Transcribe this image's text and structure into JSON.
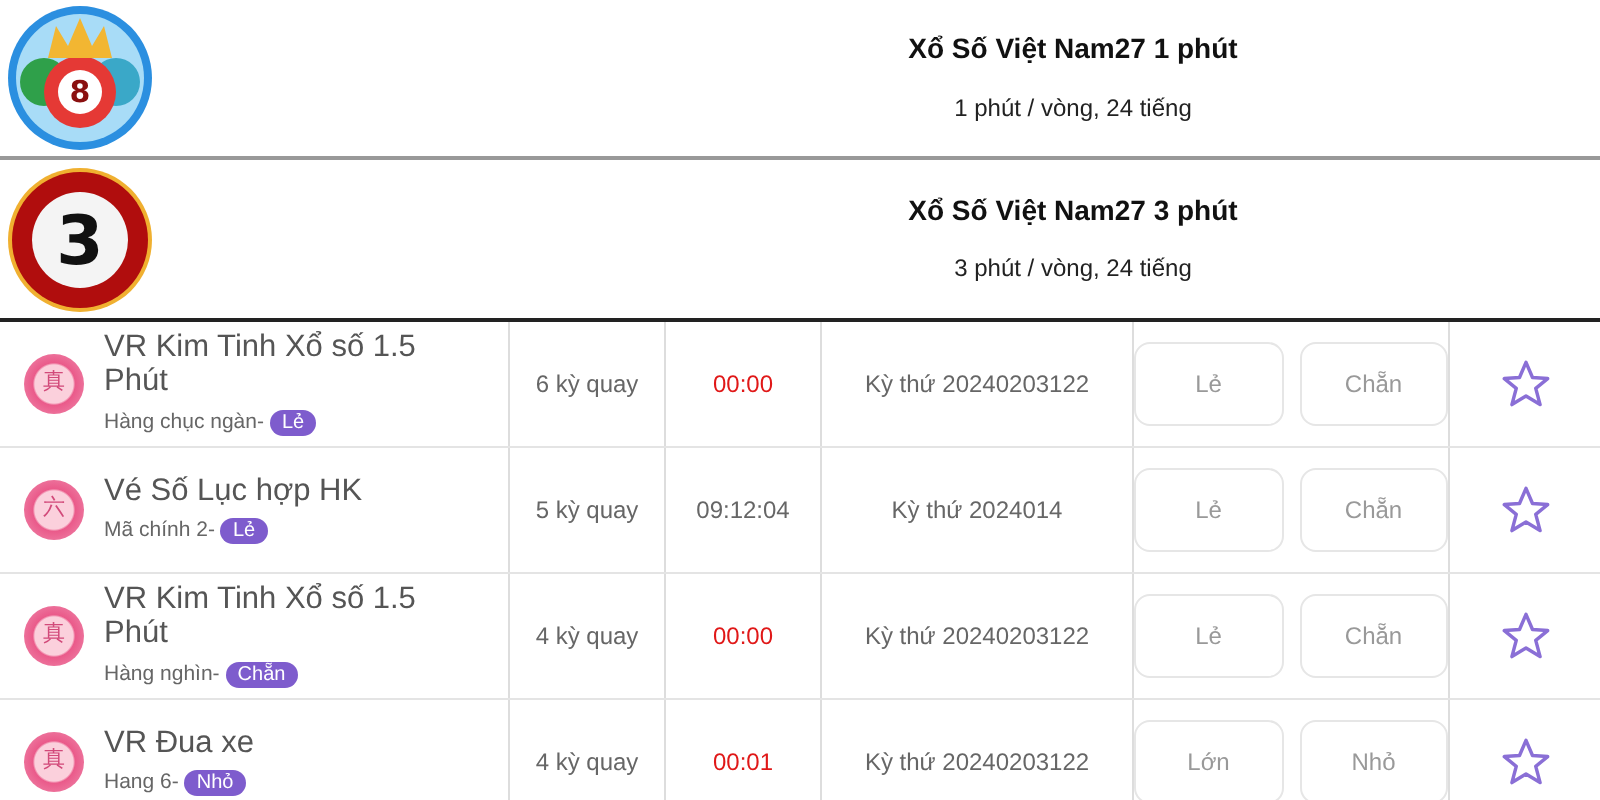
{
  "games": [
    {
      "logo_number": "8",
      "kind": "crown",
      "title": "Xổ Số Việt Nam27 1 phút",
      "subtitle": "1 phút / vòng, 24 tiếng"
    },
    {
      "logo_number": "3",
      "kind": "ring",
      "title": "Xổ Số Việt Nam27 3 phút",
      "subtitle": "3 phút / vòng, 24 tiếng"
    }
  ],
  "rows": [
    {
      "icon_char": "真",
      "name": "VR Kim Tinh Xổ số 1.5 Phút",
      "position": "Hàng chục ngàn-",
      "tag": "Lẻ",
      "draws": "6 kỳ quay",
      "time": "00:00",
      "time_urgent": true,
      "issue": "Kỳ thứ 20240203122",
      "options": [
        "Lẻ",
        "Chẵn"
      ],
      "favorite": false
    },
    {
      "icon_char": "六",
      "name": "Vé Số Lục hợp HK",
      "position": "Mã chính 2-",
      "tag": "Lẻ",
      "draws": "5 kỳ quay",
      "time": "09:12:04",
      "time_urgent": false,
      "issue": "Kỳ thứ 2024014",
      "options": [
        "Lẻ",
        "Chẵn"
      ],
      "favorite": false
    },
    {
      "icon_char": "真",
      "name": "VR Kim Tinh Xổ số 1.5 Phút",
      "position": "Hàng nghìn-",
      "tag": "Chẵn",
      "draws": "4 kỳ quay",
      "time": "00:00",
      "time_urgent": true,
      "issue": "Kỳ thứ 20240203122",
      "options": [
        "Lẻ",
        "Chẵn"
      ],
      "favorite": false
    },
    {
      "icon_char": "真",
      "name": "VR Đua xe",
      "position": "Hang 6-",
      "tag": "Nhỏ",
      "draws": "4 kỳ quay",
      "time": "00:01",
      "time_urgent": true,
      "issue": "Kỳ thứ 20240203122",
      "options": [
        "Lớn",
        "Nhỏ"
      ],
      "favorite": false
    }
  ]
}
